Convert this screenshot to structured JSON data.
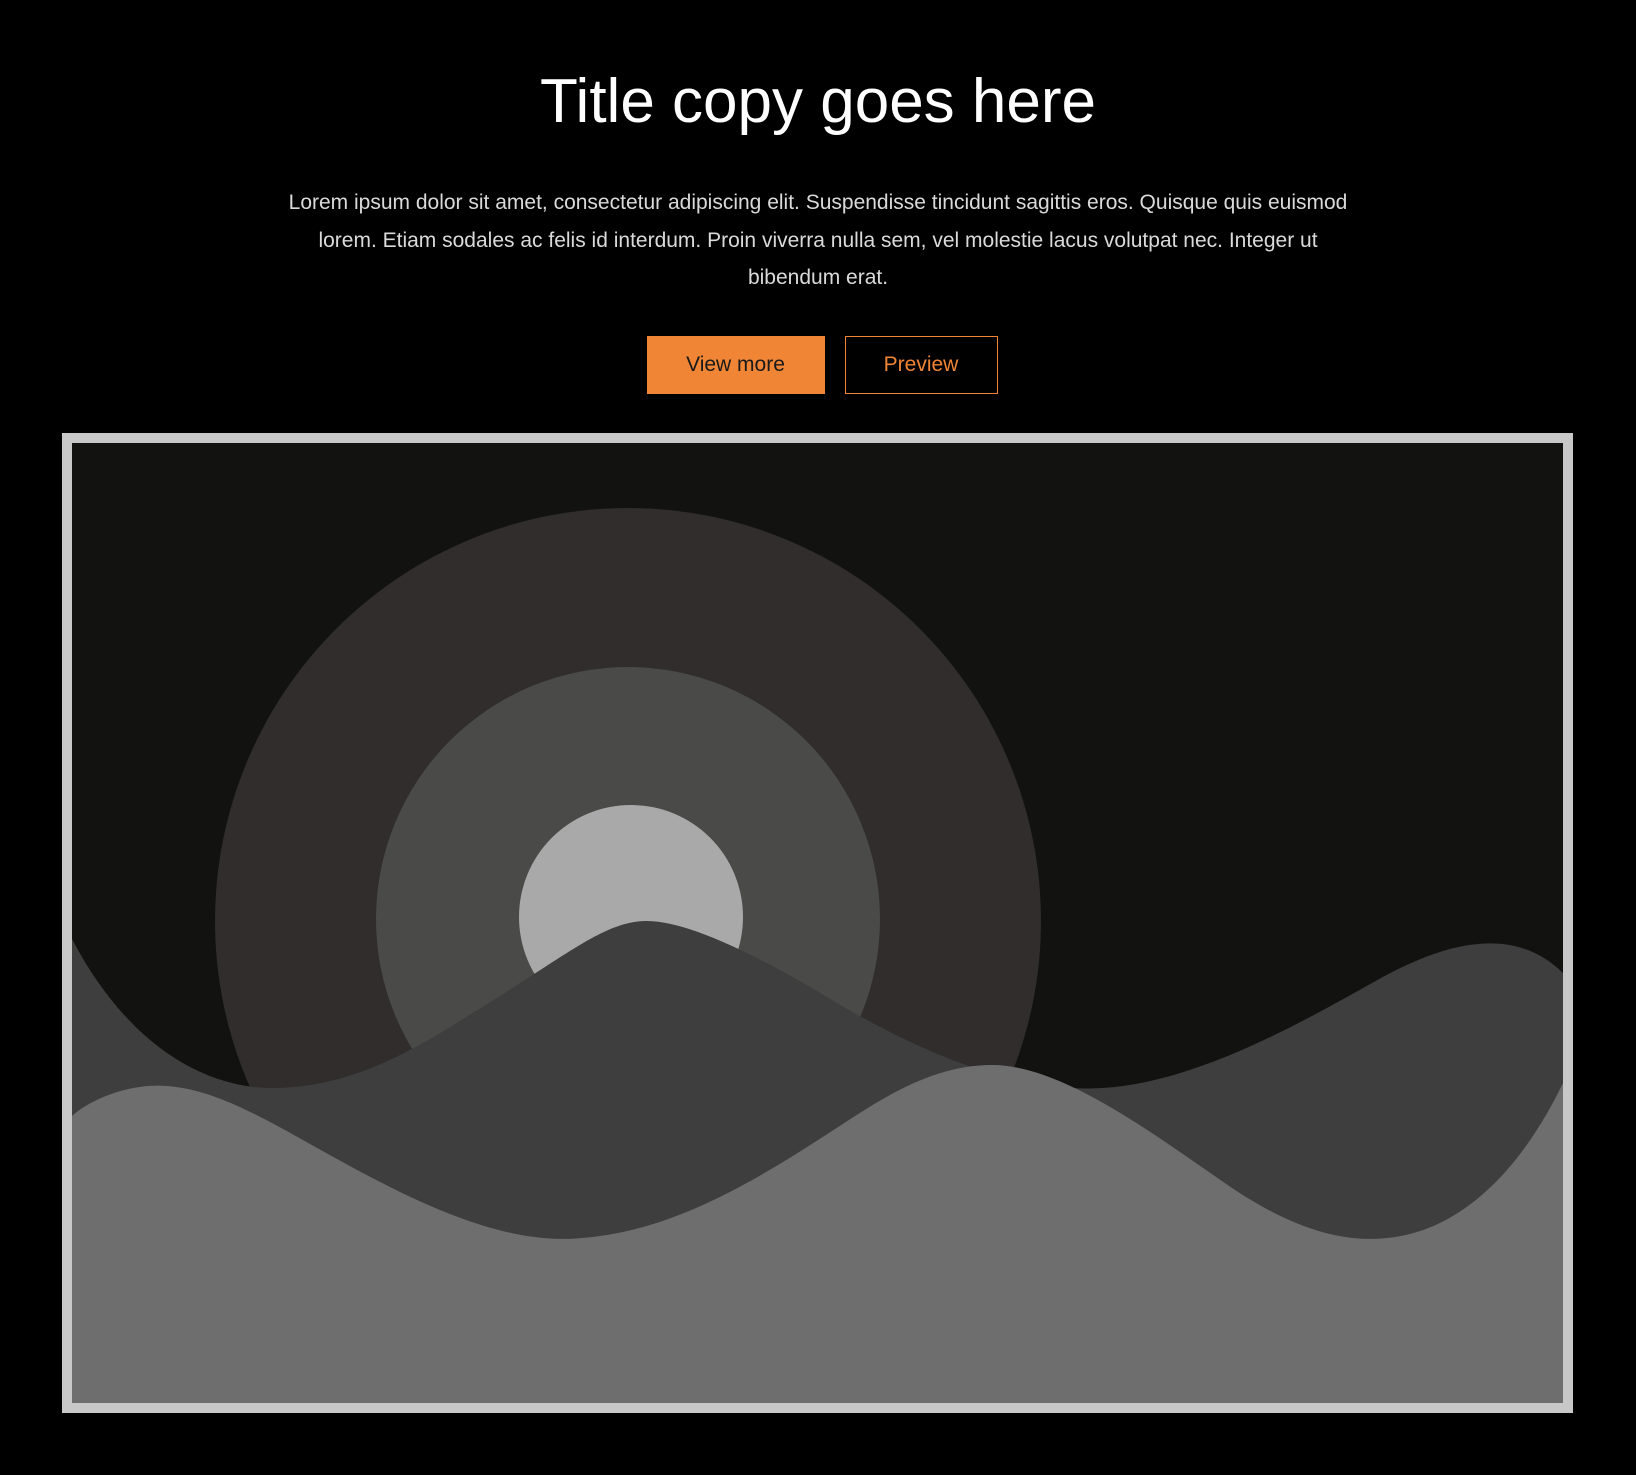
{
  "hero": {
    "title": "Title copy goes here",
    "body": "Lorem ipsum dolor sit amet, consectetur adipiscing elit. Suspendisse tincidunt sagittis eros. Quisque quis euismod lorem. Etiam sodales ac felis id interdum. Proin viverra nulla sem, vel molestie lacus volutpat nec. Integer ut bibendum erat."
  },
  "buttons": {
    "primary_label": "View more",
    "secondary_label": "Preview"
  },
  "illustration": {
    "icon": "landscape-placeholder-icon",
    "frame_color": "#c8c8c8",
    "sky_color": "#121210",
    "outer_ring_color": "#302d2c",
    "middle_ring_color": "#4a4a48",
    "sun_color": "#a9a9a9",
    "back_hills_color": "#3e3e3e",
    "front_hills_color": "#6e6e6e"
  },
  "colors": {
    "page_background": "#000000",
    "accent": "#ef8535",
    "title_text": "#ffffff",
    "body_text": "#dadada"
  }
}
